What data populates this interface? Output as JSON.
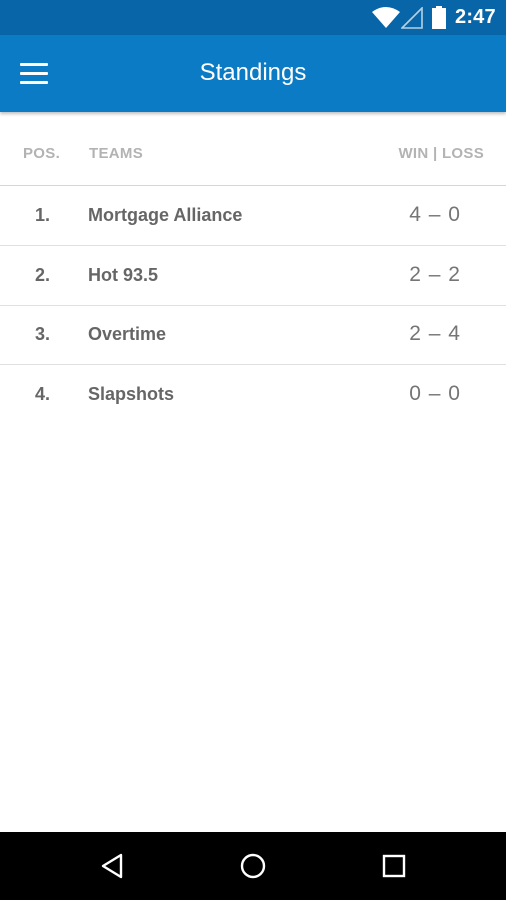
{
  "status_bar": {
    "time": "2:47",
    "icons": [
      "wifi-icon",
      "signal-icon",
      "battery-icon"
    ]
  },
  "app_bar": {
    "title": "Standings",
    "menu_icon": "menu-icon"
  },
  "table": {
    "headers": {
      "pos": "POS.",
      "teams": "TEAMS",
      "win_loss": "WIN | LOSS"
    },
    "rows": [
      {
        "pos": "1.",
        "team": "Mortgage Alliance",
        "record": "4 – 0"
      },
      {
        "pos": "2.",
        "team": "Hot 93.5",
        "record": "2 – 2"
      },
      {
        "pos": "3.",
        "team": "Overtime",
        "record": "2 – 4"
      },
      {
        "pos": "4.",
        "team": "Slapshots",
        "record": "0 – 0"
      }
    ]
  },
  "nav_bar": {
    "buttons": [
      "back-icon",
      "home-icon",
      "recent-apps-icon"
    ]
  },
  "colors": {
    "status_bar": "#0866a8",
    "app_bar": "#0a7bc4",
    "header_text": "#b3b3b3",
    "row_text": "#666666"
  }
}
